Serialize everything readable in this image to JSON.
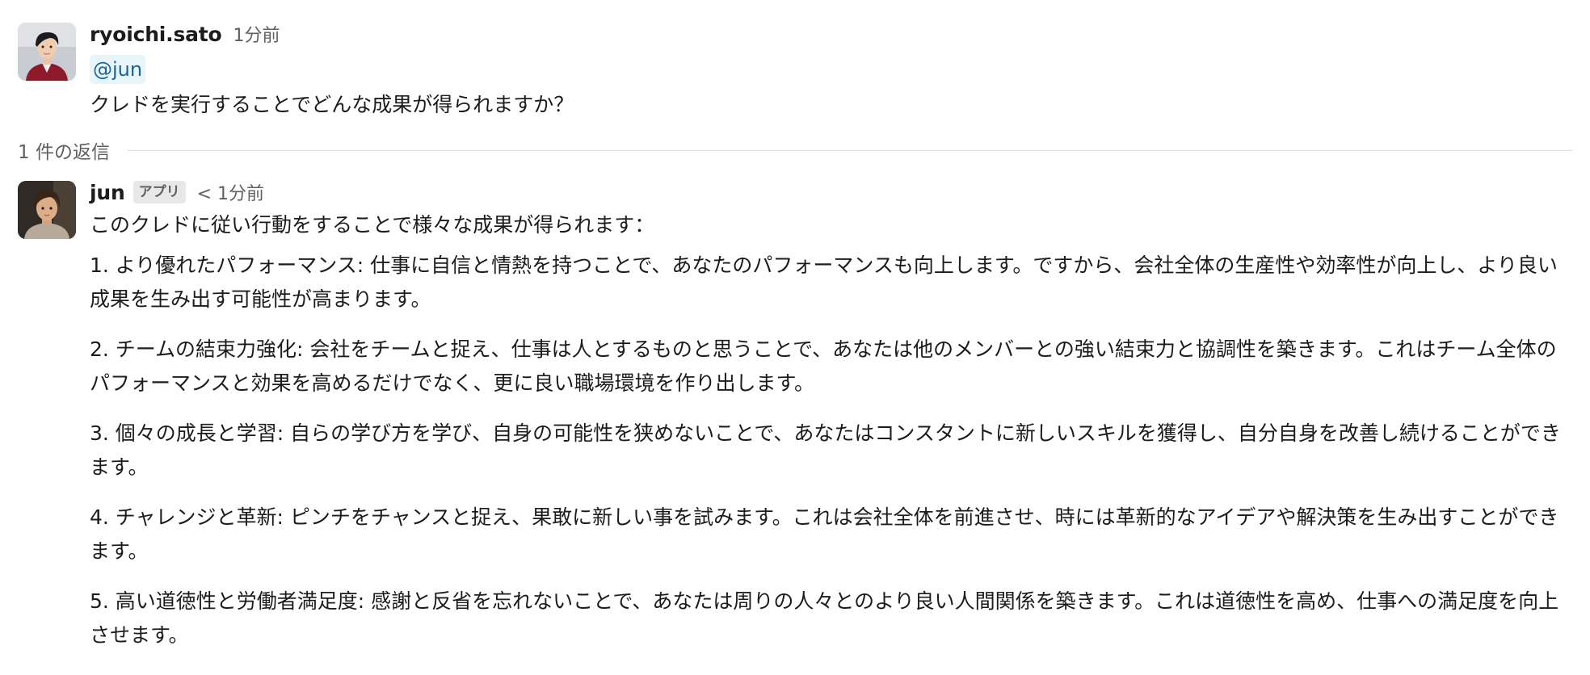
{
  "messages": [
    {
      "author": "ryoichi.sato",
      "time": "1分前",
      "mention": "@jun",
      "text": "クレドを実行することでどんな成果が得られますか？"
    }
  ],
  "thread": {
    "reply_count": "1 件の返信"
  },
  "reply": {
    "author": "jun",
    "badge": "アプリ",
    "time": "< 1分前",
    "intro": "このクレドに従い行動をすることで様々な成果が得られます：",
    "items": [
      "1. より優れたパフォーマンス: 仕事に自信と情熱を持つことで、あなたのパフォーマンスも向上します。ですから、会社全体の生産性や効率性が向上し、より良い成果を生み出す可能性が高まります。",
      "2. チームの結束力強化: 会社をチームと捉え、仕事は人とするものと思うことで、あなたは他のメンバーとの強い結束力と協調性を築きます。これはチーム全体のパフォーマンスと効果を高めるだけでなく、更に良い職場環境を作り出します。",
      "3. 個々の成長と学習: 自らの学び方を学び、自身の可能性を狭めないことで、あなたはコンスタントに新しいスキルを獲得し、自分自身を改善し続けることができます。",
      "4. チャレンジと革新: ピンチをチャンスと捉え、果敢に新しい事を試みます。これは会社全体を前進させ、時には革新的なアイデアや解決策を生み出すことができます。",
      "5. 高い道徳性と労働者満足度: 感謝と反省を忘れないことで、あなたは周りの人々とのより良い人間関係を築きます。これは道徳性を高め、仕事への満足度を向上させます。"
    ]
  },
  "colors": {
    "mention_text": "#1264a3",
    "mention_bg": "#e8f5fa",
    "muted": "#616061",
    "text": "#1d1c1d"
  }
}
